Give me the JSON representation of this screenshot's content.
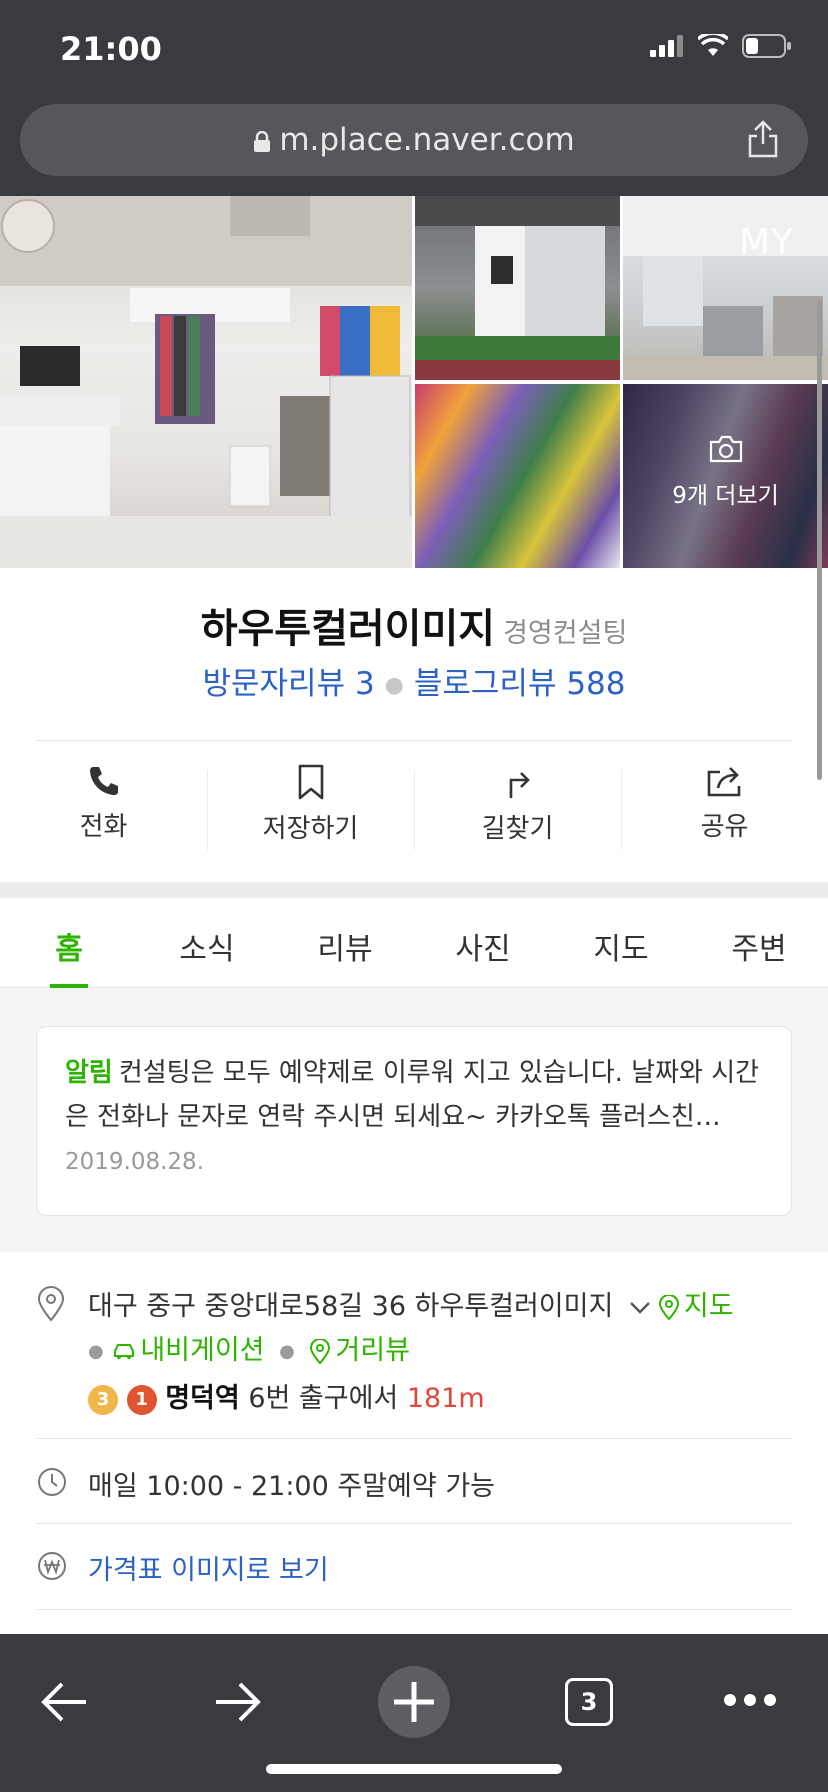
{
  "status": {
    "time": "21:00"
  },
  "browser": {
    "url": "m.place.naver.com",
    "tab_count": "3"
  },
  "photos": {
    "more_label": "9개 더보기",
    "my_label": "MY"
  },
  "place": {
    "name": "하우투컬러이미지",
    "category": "경영컨설팅",
    "visitor_reviews": "방문자리뷰 3",
    "blog_reviews": "블로그리뷰 588"
  },
  "actions": [
    {
      "label": "전화",
      "icon": "phone-icon"
    },
    {
      "label": "저장하기",
      "icon": "bookmark-icon"
    },
    {
      "label": "길찾기",
      "icon": "directions-icon"
    },
    {
      "label": "공유",
      "icon": "share-icon"
    }
  ],
  "tabs": [
    "홈",
    "소식",
    "리뷰",
    "사진",
    "지도",
    "주변"
  ],
  "active_tab": "홈",
  "notice": {
    "tag": "알림",
    "text": "컨설팅은 모두 예약제로 이루워 지고 있습니다. 날짜와 시간은 전화나 문자로 연락 주시면 되세요~ 카카오톡 플러스친…",
    "date": "2019.08.28."
  },
  "address": {
    "text": "대구 중구 중앙대로58길 36 하우투컬러이미지",
    "map_link": "지도",
    "navigation_link": "내비게이션",
    "street_view_link": "거리뷰",
    "subway_lines": [
      "3",
      "1"
    ],
    "station": "명덕역",
    "exit_text": "6번 출구에서",
    "distance": "181m"
  },
  "hours": {
    "text": "매일 10:00 - 21:00 주말예약 가능"
  },
  "price": {
    "link": "가격표 이미지로 보기"
  },
  "colors": {
    "accent": "#2db400",
    "link": "#2c62c4",
    "bar": "#3a3b3f",
    "distance": "#e2453c"
  }
}
